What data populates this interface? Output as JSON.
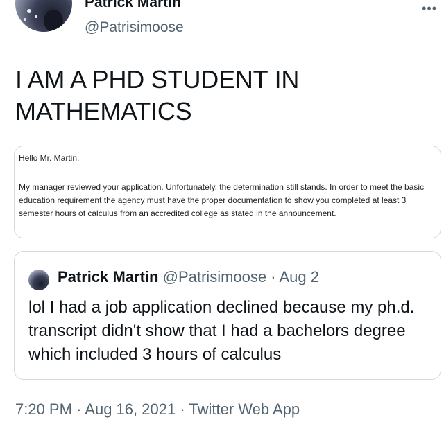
{
  "author": {
    "display_name": "Patrick Martin",
    "handle": "@Patrisimoose"
  },
  "more_icon": "more-horizontal-icon",
  "tweet": {
    "text": "I AM A PHD STUDENT IN MATHEMATICS"
  },
  "email_image": {
    "greeting": "Hello Mr. Martin,",
    "body": "My manager reviewed your application. Unfortunately, the determination still stands. In order to meet the basic education requirement the agency must have the proper documentation to show you completed at least 3 semester hours of calculus from an accredited college as stated in the announcement."
  },
  "quoted_tweet": {
    "display_name": "Patrick Martin",
    "handle": "@Patrisimoose",
    "separator": "·",
    "date": "Aug 2",
    "text": "lol I had a job application declined because my ph.d. transcript didn't show that I had a bachelors degree which included 3 hours of calculus"
  },
  "footer": {
    "time": "7:20 PM",
    "separator": "·",
    "date": "Aug 16, 2021",
    "source": "Twitter Web App"
  }
}
